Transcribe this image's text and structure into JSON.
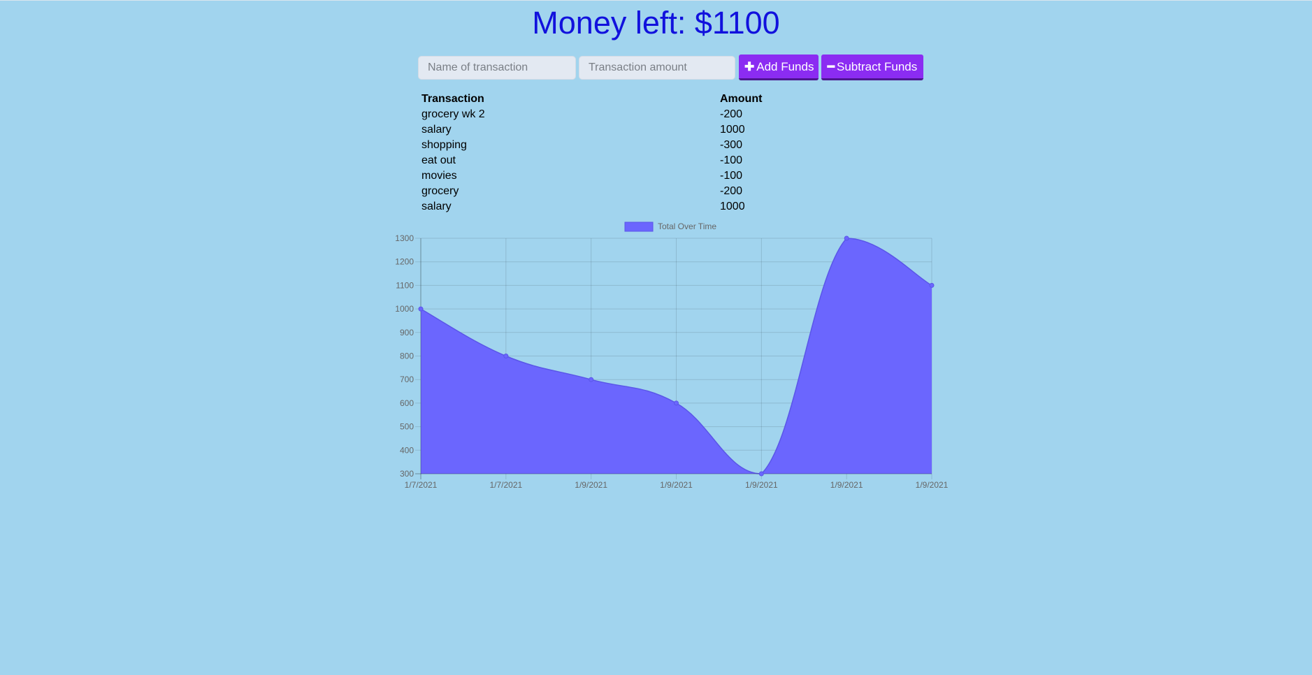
{
  "header": {
    "title": "Money left: $1100"
  },
  "form": {
    "name_placeholder": "Name of transaction",
    "amount_placeholder": "Transaction amount",
    "add_label": "Add Funds",
    "add_icon": "plus-icon",
    "subtract_label": "Subtract Funds",
    "subtract_icon": "minus-icon"
  },
  "table": {
    "headers": [
      "Transaction",
      "Amount"
    ],
    "rows": [
      [
        "grocery wk 2",
        "-200"
      ],
      [
        "salary",
        "1000"
      ],
      [
        "shopping",
        "-300"
      ],
      [
        "eat out",
        "-100"
      ],
      [
        "movies",
        "-100"
      ],
      [
        "grocery",
        "-200"
      ],
      [
        "salary",
        "1000"
      ]
    ]
  },
  "chart_data": {
    "type": "area",
    "x": [
      "1/7/2021",
      "1/7/2021",
      "1/9/2021",
      "1/9/2021",
      "1/9/2021",
      "1/9/2021",
      "1/9/2021"
    ],
    "series": [
      {
        "name": "Total Over Time",
        "values": [
          1000,
          800,
          700,
          600,
          300,
          1300,
          1100
        ],
        "color": "#6b66fe"
      }
    ],
    "ylim": [
      300,
      1300
    ],
    "yticks": [
      300,
      400,
      500,
      600,
      700,
      800,
      900,
      1000,
      1100,
      1200,
      1300
    ],
    "grid": true,
    "legend": "top"
  }
}
